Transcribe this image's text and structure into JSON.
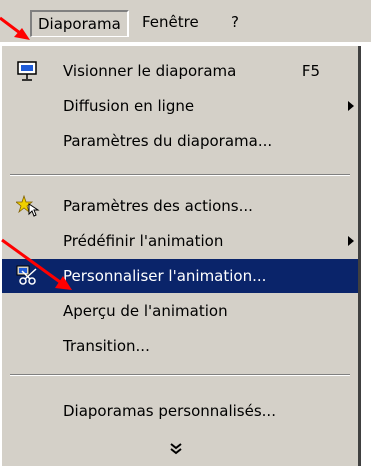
{
  "menubar": {
    "items": [
      "Diaporama",
      "Fenêtre",
      "?"
    ]
  },
  "menu": {
    "items": [
      {
        "label": "Visionner le diaporama",
        "shortcut": "F5",
        "icon": "slideshow-icon"
      },
      {
        "label": "Diffusion en ligne",
        "submenu": true
      },
      {
        "label": "Paramètres du diaporama..."
      },
      {
        "label": "Paramètres des actions...",
        "icon": "action-settings-icon"
      },
      {
        "label": "Prédéfinir l'animation",
        "submenu": true
      },
      {
        "label": "Personnaliser l'animation...",
        "icon": "custom-animation-icon",
        "highlighted": true
      },
      {
        "label": "Aperçu de l'animation"
      },
      {
        "label": "Transition..."
      },
      {
        "label": "Diaporamas personnalisés..."
      }
    ],
    "expand_icon": "double-chevron-down-icon"
  },
  "colors": {
    "menu_bg": "#d4d0c8",
    "highlight_bg": "#0a246a",
    "annotation_arrow": "#ff0000",
    "decor_blue": "#1e5bd8"
  }
}
